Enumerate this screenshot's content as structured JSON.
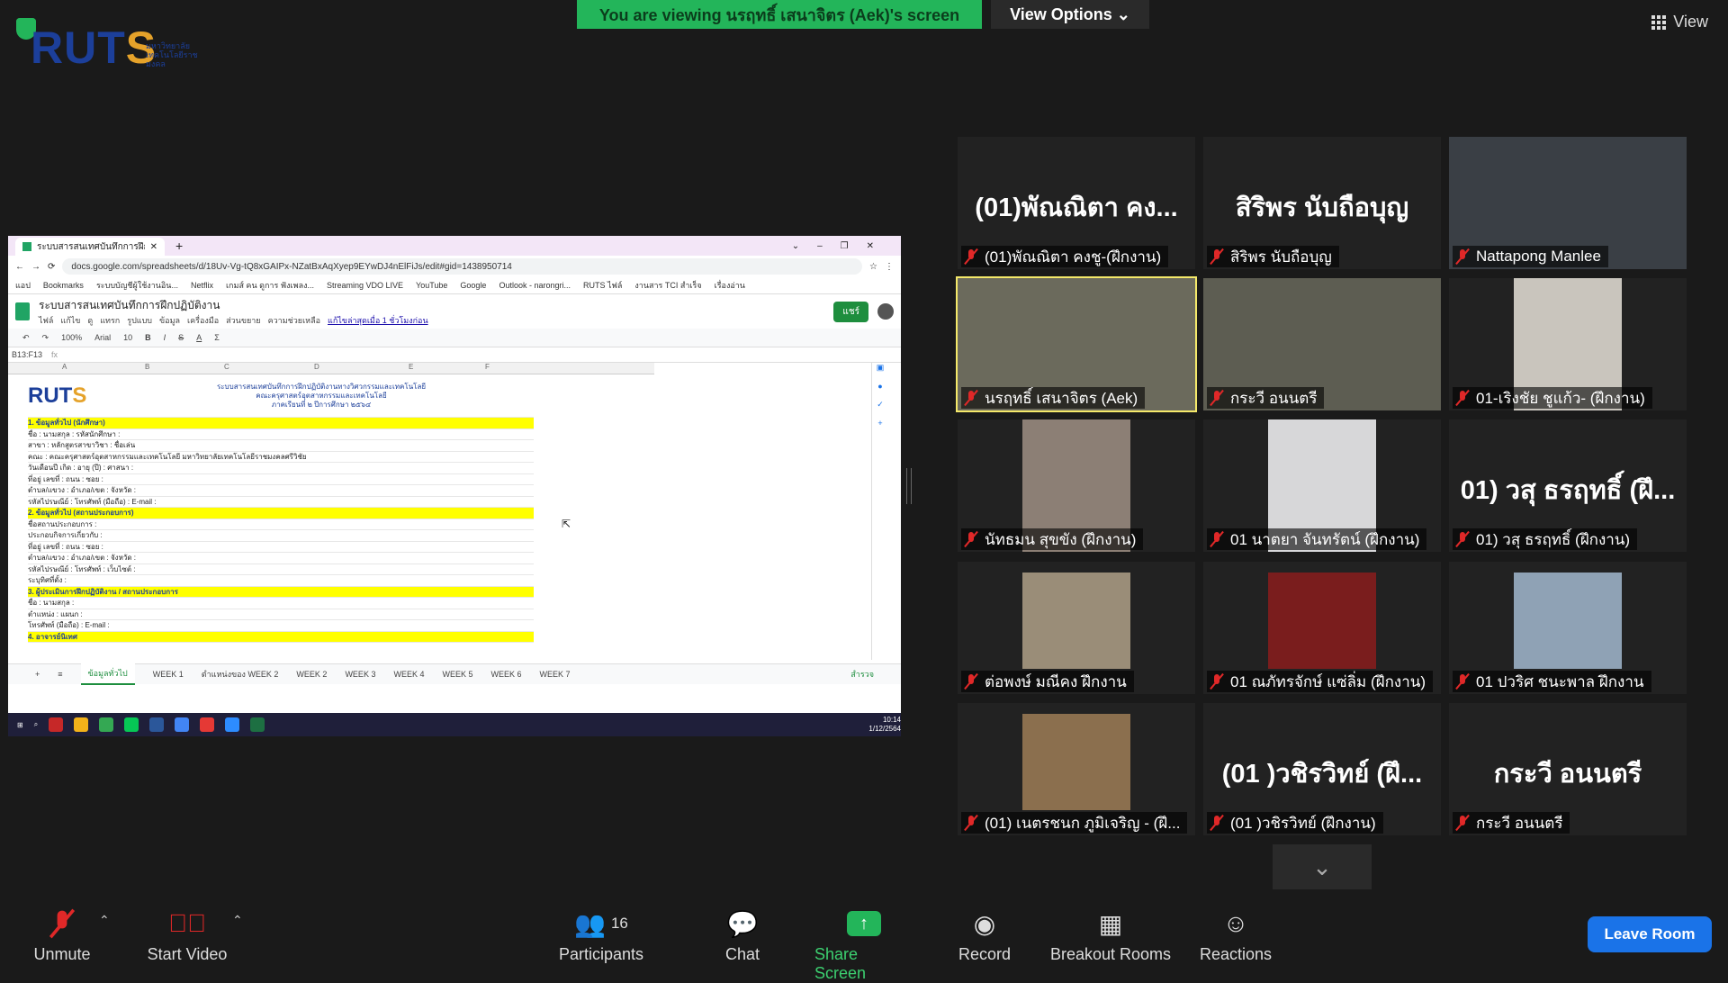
{
  "banner": {
    "text": "You are viewing นรฤทธิ์ เสนาจิตร (Aek)'s screen",
    "view_options": "View Options ⌄"
  },
  "view_button": "View",
  "logo": {
    "part1": "RUT",
    "part2": "S",
    "sub": "มหาวิทยาลัยเทคโนโลยีราชมงคล"
  },
  "shared_screen": {
    "browser_tab": "ระบบสารสนเทศบันทึกการฝึกปฏิบัติงาน",
    "url": "docs.google.com/spreadsheets/d/18Uv-Vg-tQ8xGAIPx-NZatBxAqXyep9EYwDJ4nElFiJs/edit#gid=1438950714",
    "bookmarks": [
      "แอป",
      "Bookmarks",
      "ระบบบัญชีผู้ใช้งานอิน...",
      "Netflix",
      "เกมส์ คน ดูการ ฟังเพลง...",
      "Streaming VDO LIVE",
      "YouTube",
      "Google",
      "Outlook - narongri...",
      "RUTS ไฟล์",
      "งานสาร TCI สำเร็จ",
      "เรื่องอ่าน"
    ],
    "doc_title": "ระบบสารสนเทศบันทึกการฝึกปฏิบัติงาน",
    "menu": [
      "ไฟล์",
      "แก้ไข",
      "ดู",
      "แทรก",
      "รูปแบบ",
      "ข้อมูล",
      "เครื่องมือ",
      "ส่วนขยาย",
      "ความช่วยเหลือ",
      "แก้ไขล่าสุดเมื่อ 1 ชั่วโมงก่อน"
    ],
    "share_label": "แชร์",
    "cell_ref": "B13:F13",
    "zoom": "100%",
    "font": "Arial",
    "font_size": "10",
    "columns": [
      "A",
      "B",
      "C",
      "D",
      "E",
      "F"
    ],
    "sheet_title": [
      "ระบบสารสนเทศบันทึกการฝึกปฏิบัติงานทางวิศวกรรมและเทคโนโลยี",
      "คณะครุศาสตร์อุตสาหกรรมและเทคโนโลยี",
      "ภาคเรียนที่ ๒ ปีการศึกษา ๒๕๖๔"
    ],
    "rows": [
      {
        "type": "yellow",
        "text": "1. ข้อมูลทั่วไป (นักศึกษา)"
      },
      {
        "type": "normal",
        "text": "ชื่อ :                                  นามสกุล :                                รหัสนักศึกษา :"
      },
      {
        "type": "normal",
        "text": "สาขา :                                หลักสูตรสาขาวิชา :                          ชื่อเล่น"
      },
      {
        "type": "normal",
        "text": "คณะ :  คณะครุศาสตร์อุตสาหกรรมและเทคโนโลยี มหาวิทยาลัยเทคโนโลยีราชมงคลศรีวิชัย"
      },
      {
        "type": "normal",
        "text": "วันเดือนปี เกิด :                      อายุ (ปี) :                                ศาสนา :"
      },
      {
        "type": "normal",
        "text": "ที่อยู่ เลขที่ :                       ถนน :                                      ซอย :"
      },
      {
        "type": "normal",
        "text": "ตำบล/แขวง :                          อำเภอ/เขต :                                จังหวัด :"
      },
      {
        "type": "normal",
        "text": "รหัสไปรษณีย์ :                       โทรศัพท์ (มือถือ) :                         E-mail :"
      },
      {
        "type": "yellow",
        "text": "2. ข้อมูลทั่วไป (สถานประกอบการ)"
      },
      {
        "type": "normal",
        "text": "ชื่อสถานประกอบการ :"
      },
      {
        "type": "normal",
        "text": "ประกอบกิจการเกี่ยวกับ :"
      },
      {
        "type": "normal",
        "text": "ที่อยู่ เลขที่ :                       ถนน :                                      ซอย :"
      },
      {
        "type": "normal",
        "text": "ตำบล/แขวง :                          อำเภอ/เขต :                                จังหวัด :"
      },
      {
        "type": "normal",
        "text": "รหัสไปรษณีย์ :                       โทรศัพท์ :                                  เว็บไซต์ :"
      },
      {
        "type": "normal",
        "text": "ระบุทิศที่ตั้ง :"
      },
      {
        "type": "yellow",
        "text": "3. ผู้ประเมินการฝึกปฏิบัติงาน / สถานประกอบการ"
      },
      {
        "type": "normal",
        "text": "ชื่อ :                                  นามสกุล :"
      },
      {
        "type": "normal",
        "text": "ตำแหน่ง :                             แผนก :"
      },
      {
        "type": "normal",
        "text": "โทรศัพท์ (มือถือ) :                    E-mail :"
      },
      {
        "type": "yellow",
        "text": "4. อาจารย์นิเทศ"
      }
    ],
    "sheet_tabs": [
      "ข้อมูลทั่วไป",
      "WEEK 1",
      "ตำแหน่งของ WEEK 2",
      "WEEK 2",
      "WEEK 3",
      "WEEK 4",
      "WEEK 5",
      "WEEK 6",
      "WEEK 7"
    ],
    "sheet_side_label": "สำรวจ",
    "clock": {
      "time": "10:14",
      "date": "1/12/2564"
    }
  },
  "tiles": [
    {
      "big": "(01)พัณณิตา คง...",
      "name": "(01)พัณณิตา คงชู-(ฝึกงาน)",
      "video": false
    },
    {
      "big": "สิริพร นับถือบุญ",
      "name": "สิริพร นับถือบุญ",
      "video": false
    },
    {
      "big": "",
      "name": "Nattapong Manlee",
      "video": true,
      "bg": "#3a3f45"
    },
    {
      "big": "",
      "name": "นรฤทธิ์ เสนาจิตร (Aek)",
      "video": true,
      "active": true,
      "bg": "#6b6a5c"
    },
    {
      "big": "",
      "name": "กระวี อนนตรี",
      "video": true,
      "bg": "#5d5d52"
    },
    {
      "big": "",
      "name": "01-เริงชัย ชูแก้ว- (ฝึกงาน)",
      "video": true,
      "bg": "#c9c5bd",
      "narrow": true
    },
    {
      "big": "",
      "name": "นัทธมน สุขขัง (ฝึกงาน)",
      "video": true,
      "bg": "#8c7f75",
      "narrow": true
    },
    {
      "big": "",
      "name": "01 นาตยา จันทรัตน์ (ฝึกงาน)",
      "video": true,
      "bg": "#d7d7d9",
      "narrow": true
    },
    {
      "big": "01) วสุ ธรฤทธิ์ (ฝึ...",
      "name": "01) วสุ ธรฤทธิ์ (ฝึกงาน)",
      "video": false
    },
    {
      "big": "",
      "name": "ต่อพงษ์ มณีคง ฝึกงาน",
      "video": true,
      "bg": "#9a8d78",
      "narrow": true
    },
    {
      "big": "",
      "name": "01 ณภัทรจักษ์ แซ่ลิ่ม (ฝึกงาน)",
      "video": true,
      "bg": "#7a1d1d",
      "narrow": true
    },
    {
      "big": "",
      "name": "01 ปวริศ ชนะพาล ฝึกงาน",
      "video": true,
      "bg": "#8fa2b5",
      "narrow": true
    },
    {
      "big": "",
      "name": "(01) เนตรชนก ภูมิเจริญ - (ฝึ...",
      "video": true,
      "bg": "#8b6f4e",
      "narrow": true
    },
    {
      "big": "(01 )วชิรวิทย์ (ฝึ...",
      "name": "(01 )วชิรวิทย์ (ฝึกงาน)",
      "video": false
    },
    {
      "big": "กระวี อนนตรี",
      "name": "กระวี อนนตรี",
      "video": false
    }
  ],
  "toolbar": {
    "unmute": "Unmute",
    "start_video": "Start Video",
    "participants": "Participants",
    "participants_count": "16",
    "chat": "Chat",
    "share_screen": "Share Screen",
    "record": "Record",
    "breakout": "Breakout Rooms",
    "reactions": "Reactions",
    "leave": "Leave Room"
  },
  "colors": {
    "banner": "#23b55a",
    "muted": "#e02828",
    "active_speaker": "#f5e96a",
    "leave": "#1a73e8",
    "share_icon": "#23b55a"
  }
}
